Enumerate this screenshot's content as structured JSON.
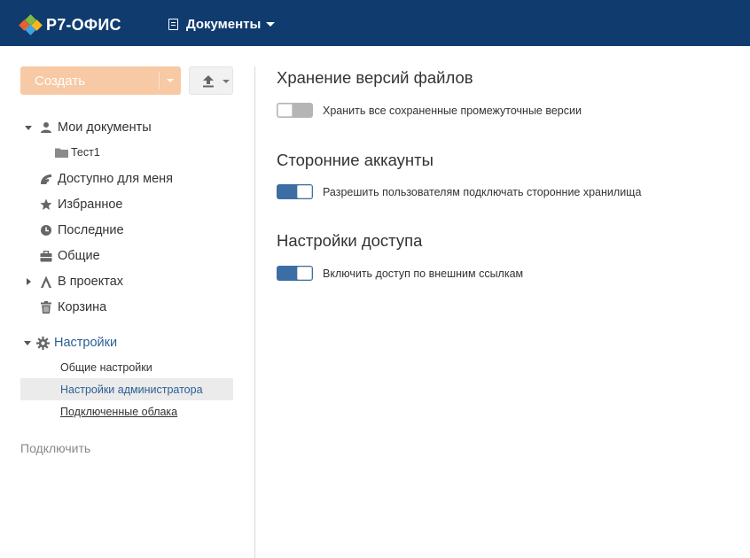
{
  "header": {
    "logo_text": "Р7-ОФИС",
    "product_label": "Документы",
    "colors": {
      "bar": "#0f3b6f"
    }
  },
  "sidebar": {
    "create_label": "Создать",
    "upload_icon": "upload-icon",
    "tree": [
      {
        "label": "Мои документы",
        "icon": "person-icon",
        "expanded": true
      },
      {
        "label": "Тест1",
        "icon": "folder-icon"
      },
      {
        "label": "Доступно для меня",
        "icon": "share-icon"
      },
      {
        "label": "Избранное",
        "icon": "star-icon"
      },
      {
        "label": "Последние",
        "icon": "clock-icon"
      },
      {
        "label": "Общие",
        "icon": "briefcase-icon"
      },
      {
        "label": "В проектах",
        "icon": "projects-icon",
        "expanded": false
      },
      {
        "label": "Корзина",
        "icon": "trash-icon"
      }
    ],
    "settings": {
      "label": "Настройки",
      "items": [
        {
          "label": "Общие настройки"
        },
        {
          "label": "Настройки администратора",
          "active": true
        },
        {
          "label": "Подключенные облака"
        }
      ]
    },
    "connect_label": "Подключить"
  },
  "main": {
    "sections": [
      {
        "title": "Хранение версий файлов",
        "toggle_label": "Хранить все сохраненные промежуточные версии",
        "enabled": false
      },
      {
        "title": "Сторонние аккаунты",
        "toggle_label": "Разрешить пользователям подключать сторонние хранилища",
        "enabled": true
      },
      {
        "title": "Настройки доступа",
        "toggle_label": "Включить доступ по внешним ссылкам",
        "enabled": true
      }
    ],
    "colors": {
      "toggle_on": "#3c6ea5",
      "toggle_off": "#b5b5b5",
      "link": "#2b5f95",
      "create_button": "#f7c9a5"
    }
  }
}
